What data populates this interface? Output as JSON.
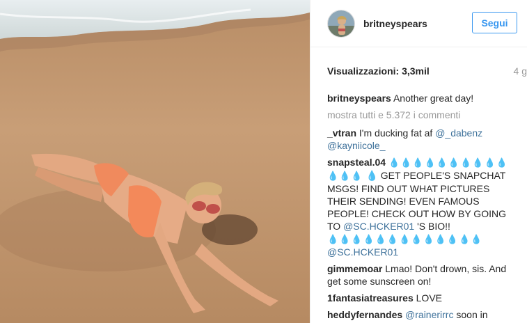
{
  "header": {
    "username": "britneyspears",
    "follow_label": "Segui"
  },
  "stats": {
    "views": "Visualizzazioni: 3,3mil",
    "time": "4 g"
  },
  "caption": {
    "user": "britneyspears",
    "text": "Another great day!"
  },
  "more_comments": "mostra tutti e 5.372 i commenti",
  "comments": [
    {
      "user": "_vtran",
      "text": "I'm ducking fat af",
      "mention1": "@_dabenz",
      "mention2": "@kayniicole_"
    },
    {
      "user": "snapsteal.04",
      "drops1": "💧💧💧💧💧💧💧💧💧💧💧💧💧",
      "text1": "💧 GET PEOPLE'S SNAPCHAT MSGS! FIND OUT WHAT PICTURES THEIR SENDING! EVEN FAMOUS PEOPLE! CHECK OUT HOW BY GOING TO",
      "mention": "@SC.HCKER01",
      "text2": "'S BIO!!",
      "drops2": "💧💧💧💧💧💧💧💧💧💧💧💧💧",
      "mention2": "@SC.HCKER01"
    },
    {
      "user": "gimmemoar",
      "text": "Lmao! Don't drown, sis. And get some sunscreen on!"
    },
    {
      "user": "1fantasiatreasures",
      "text": "LOVE"
    },
    {
      "user": "heddyfernandes",
      "mention": "@rainerirrc",
      "text": "soon in"
    }
  ],
  "icons": {
    "avatar": "profile-avatar",
    "media": "video-photo"
  }
}
